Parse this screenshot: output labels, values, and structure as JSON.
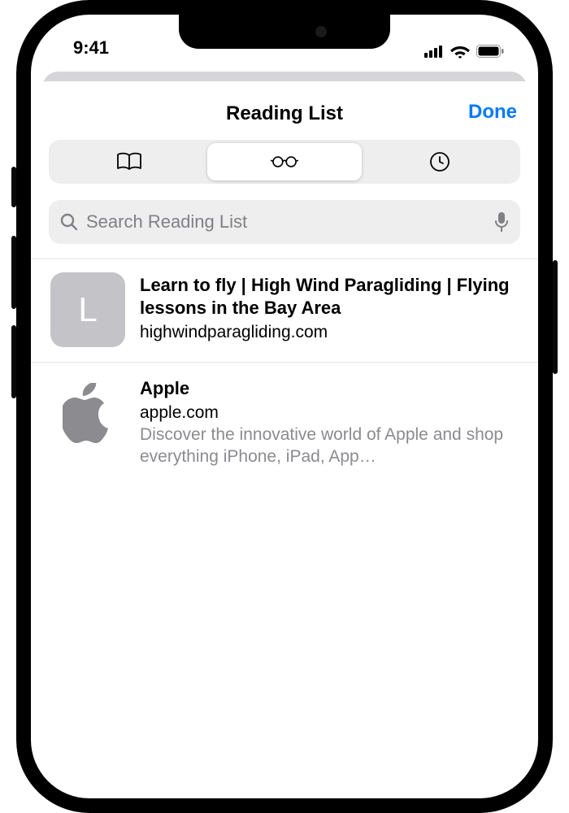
{
  "status": {
    "time": "9:41"
  },
  "header": {
    "title": "Reading List",
    "done": "Done"
  },
  "tabs": {
    "bookmarks_icon": "book-icon",
    "readinglist_icon": "glasses-icon",
    "history_icon": "clock-icon",
    "selected": 1
  },
  "search": {
    "placeholder": "Search Reading List"
  },
  "items": [
    {
      "thumb_letter": "L",
      "title": "Learn to fly | High Wind Paragliding | Flying lessons in the Bay Area",
      "domain": "highwindparagliding.com",
      "desc": ""
    },
    {
      "thumb_letter": "",
      "title": "Apple",
      "domain": "apple.com",
      "desc": "Discover the innovative world of Apple and shop everything iPhone, iPad, App…"
    }
  ]
}
